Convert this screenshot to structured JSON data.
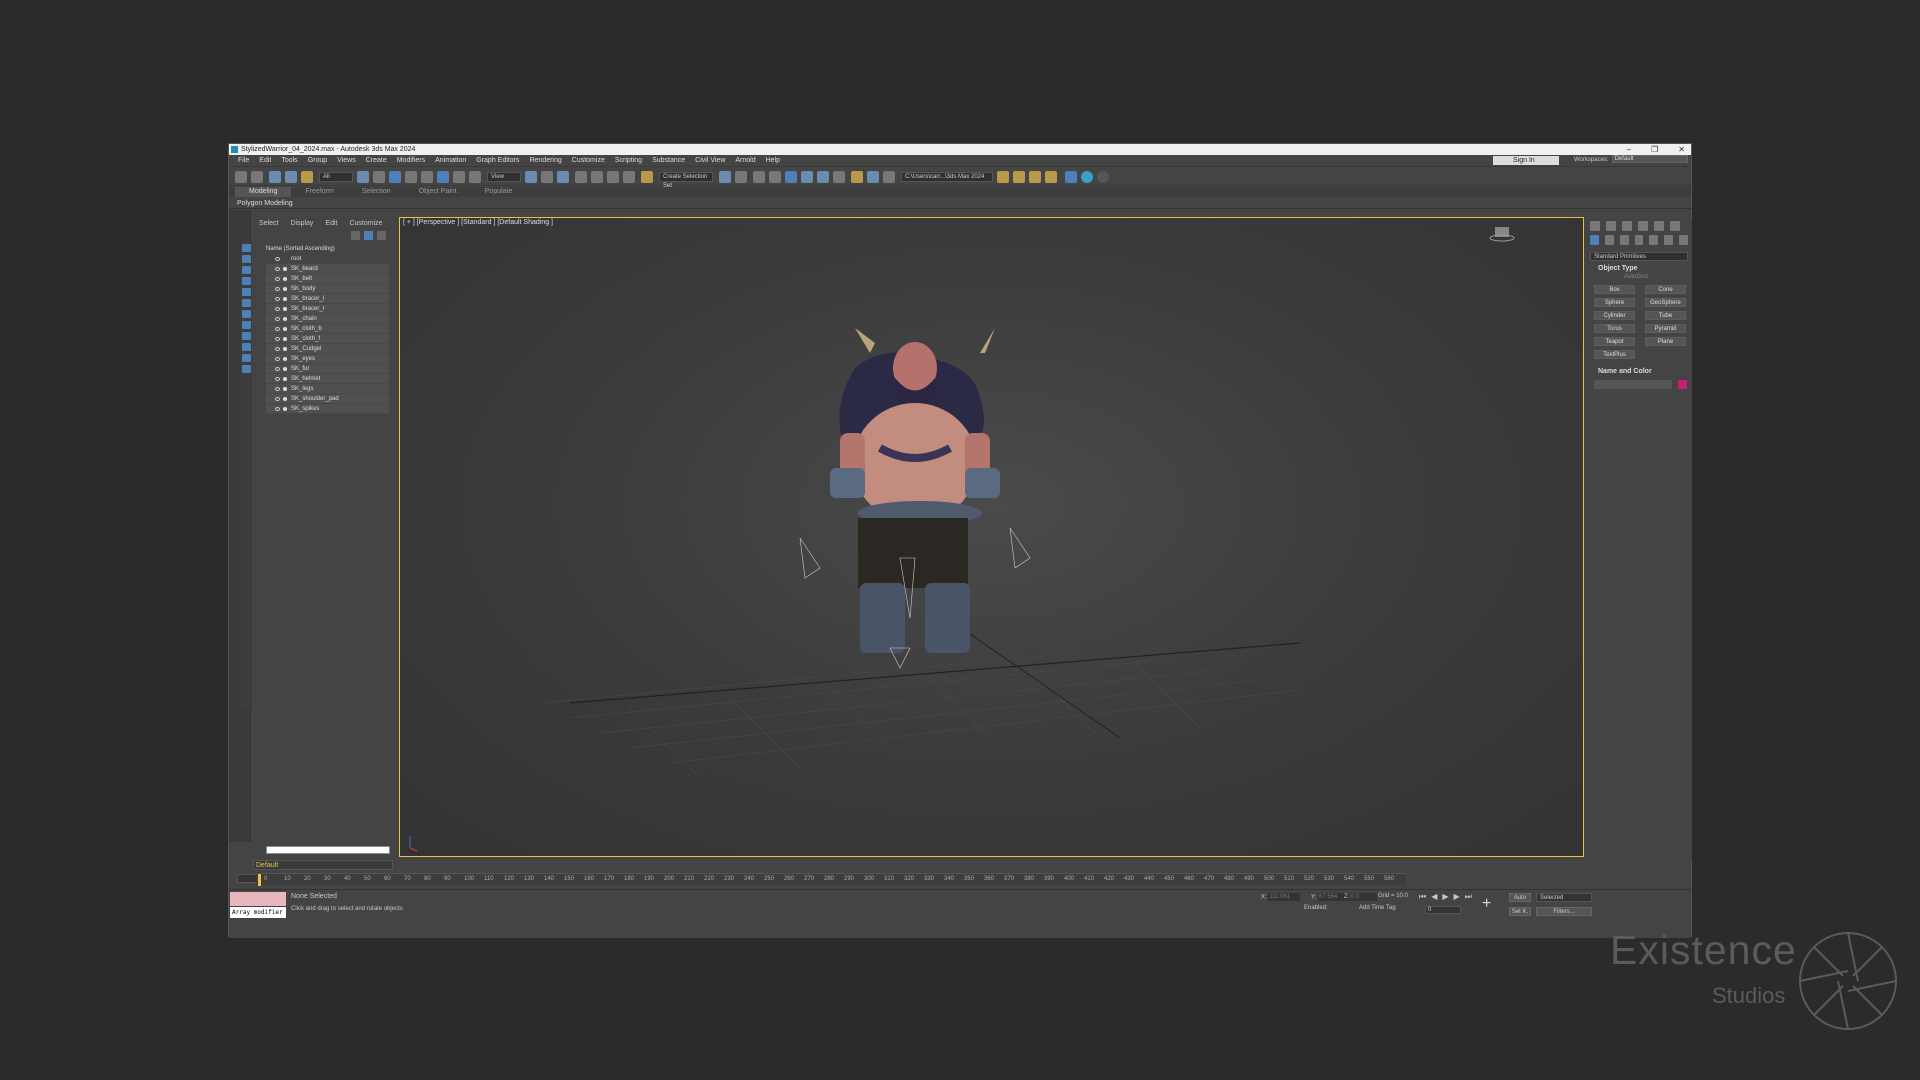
{
  "window": {
    "title": "StylizedWarrior_04_2024.max - Autodesk 3ds Max 2024",
    "controls": [
      "–",
      "❐",
      "✕"
    ]
  },
  "menu": [
    "File",
    "Edit",
    "Tools",
    "Group",
    "Views",
    "Create",
    "Modifiers",
    "Animation",
    "Graph Editors",
    "Rendering",
    "Customize",
    "Scripting",
    "Substance",
    "Civil View",
    "Arnold",
    "Help"
  ],
  "account": {
    "sign_in": "Sign In",
    "workspaces_label": "Workspaces:",
    "workspace": "Default"
  },
  "toolbar": {
    "filter": "All",
    "ref_coord": "View",
    "selection_set": "Create Selection Set",
    "project_path": "C:\\Users\\carr...\\3ds Max 2024"
  },
  "ribbon": {
    "tabs": [
      "Modeling",
      "Freeform",
      "Selection",
      "Object Paint",
      "Populate"
    ],
    "active": "Modeling",
    "panel": "Polygon Modeling"
  },
  "scene_explorer": {
    "menus": [
      "Select",
      "Display",
      "Edit",
      "Customize"
    ],
    "header": "Name (Sorted Ascending)",
    "items": [
      "root",
      "SK_beard",
      "SK_belt",
      "SK_body",
      "SK_bracer_l",
      "SK_bracer_r",
      "SK_chain",
      "SK_cloth_b",
      "SK_cloth_f",
      "SK_Cudgel",
      "SK_eyes",
      "SK_fur",
      "SK_helmet",
      "SK_legs",
      "SK_shoulder_pad",
      "SK_spikes"
    ],
    "layer": "Default",
    "frame": "0 / 569"
  },
  "viewport": {
    "label": "[ + ] [Perspective ] [Standard ] [Default Shading ]"
  },
  "command_panel": {
    "dropdown": "Standard Primitives",
    "object_type": "Object Type",
    "autogrid": "AutoGrid",
    "primitives": [
      "Box",
      "Cone",
      "Sphere",
      "GeoSphere",
      "Cylinder",
      "Tube",
      "Torus",
      "Pyramid",
      "Teapot",
      "Plane",
      "TextPlus"
    ],
    "name_and_color": "Name and Color",
    "object_color": "#c81e73"
  },
  "timeline": {
    "ticks": [
      "0",
      "10",
      "20",
      "30",
      "40",
      "50",
      "60",
      "70",
      "80",
      "90",
      "100",
      "110",
      "120",
      "130",
      "140",
      "150",
      "160",
      "170",
      "180",
      "190",
      "200",
      "210",
      "220",
      "230",
      "240",
      "250",
      "260",
      "270",
      "280",
      "290",
      "300",
      "310",
      "320",
      "330",
      "340",
      "350",
      "360",
      "370",
      "380",
      "390",
      "400",
      "410",
      "420",
      "430",
      "440",
      "450",
      "460",
      "470",
      "480",
      "490",
      "500",
      "510",
      "520",
      "530",
      "540",
      "550",
      "560"
    ]
  },
  "status": {
    "selection": "None Selected",
    "prompt": "Click and drag to select and rotate objects",
    "maxscript_input": "Array modifier",
    "x_label": "X:",
    "x_value": "111.061",
    "y_label": "Y:",
    "y_value": "67.564",
    "z_label": "Z:",
    "z_value": "0.0",
    "grid": "Grid = 10.0",
    "enabled": "Enabled:",
    "add_time_tag": "Add Time Tag",
    "auto_key": "Auto",
    "set_key": "Set K.",
    "key_filter": "Selected",
    "filters": "Filters...",
    "current_frame": "0"
  },
  "watermark": {
    "line1": "Existence",
    "line2": "Studios"
  },
  "colors": {
    "accent": "#e6c24a",
    "blue": "#4d7fb8",
    "panel": "#444444"
  }
}
